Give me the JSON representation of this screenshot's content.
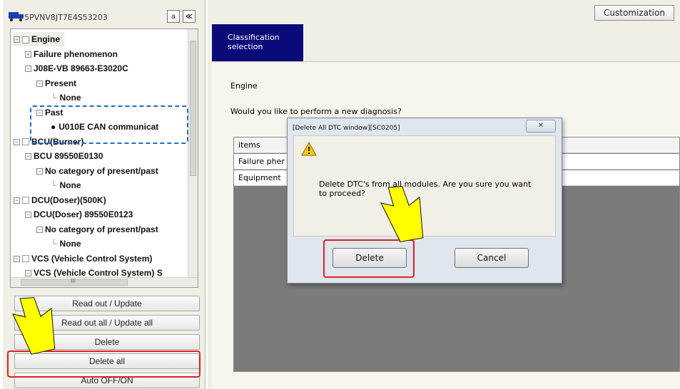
{
  "vehicle": {
    "vin": "5PVNV8JT7E4S53203",
    "a_label": "a",
    "collapse_label": "≪"
  },
  "tree": {
    "rows": [
      {
        "label": "Engine",
        "toggle": "−",
        "checkbox": true
      },
      {
        "label": "Failure phenomenon",
        "toggle": "+",
        "checkbox": false
      },
      {
        "label": "J08E-VB 89663-E3020C",
        "toggle": "−",
        "checkbox": false
      },
      {
        "label": "Present",
        "toggle": "−",
        "checkbox": false
      },
      {
        "label": "None",
        "toggle": "",
        "checkbox": false
      },
      {
        "label": "Past",
        "toggle": "−",
        "checkbox": false
      },
      {
        "label": "U010E CAN communicat",
        "toggle": "",
        "checkbox": false
      },
      {
        "label": "BCU(Burner)",
        "toggle": "−",
        "checkbox": true
      },
      {
        "label": "BCU 89550E0130",
        "toggle": "−",
        "checkbox": false
      },
      {
        "label": "No category of present/past",
        "toggle": "−",
        "checkbox": false
      },
      {
        "label": "None",
        "toggle": "",
        "checkbox": false
      },
      {
        "label": "DCU(Doser)(500K)",
        "toggle": "−",
        "checkbox": true
      },
      {
        "label": "DCU(Doser) 89550E0123",
        "toggle": "−",
        "checkbox": false
      },
      {
        "label": "No category of present/past",
        "toggle": "−",
        "checkbox": false
      },
      {
        "label": "None",
        "toggle": "",
        "checkbox": false
      },
      {
        "label": "VCS (Vehicle Control System)",
        "toggle": "−",
        "checkbox": true
      },
      {
        "label": "VCS (Vehicle Control System) S",
        "toggle": "−",
        "checkbox": false
      }
    ],
    "hscroll_label": "III"
  },
  "left_buttons": {
    "read_out": "Read out / Update",
    "read_out_all": "Read out all / Update all",
    "delete": "Delete",
    "delete_all": "Delete all",
    "auto_off_on": "Auto OFF/ON"
  },
  "header": {
    "customization": "Customization",
    "classification_tab": "Classification selection"
  },
  "main": {
    "engine_label": "Engine",
    "question": "Would you like to perform a new diagnosis?",
    "grid_rows": [
      "items",
      "Failure pher",
      "Equipment"
    ]
  },
  "dialog": {
    "title": "[Delete All DTC window][SC0205]",
    "close": "✕",
    "message": "Delete DTC's from all modules. Are you sure you want to proceed?",
    "delete_button": "Delete",
    "cancel_button": "Cancel"
  },
  "colors": {
    "highlight_red": "#e0202a",
    "dashed_blue": "#1d6fc4",
    "arrow_yellow": "#ffff00",
    "tab_navy": "#0a0a78"
  }
}
